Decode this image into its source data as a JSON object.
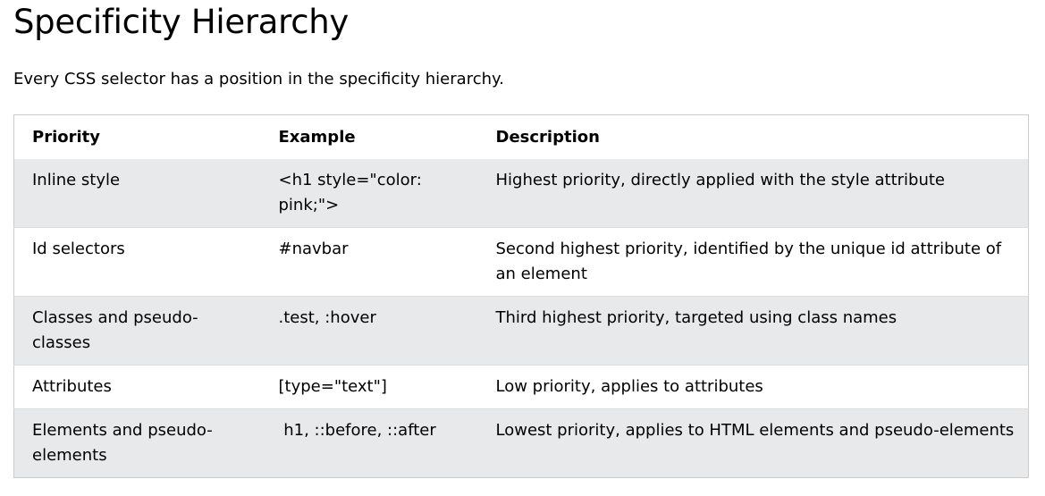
{
  "heading": "Specificity Hierarchy",
  "intro": "Every CSS selector has a position in the specificity hierarchy.",
  "table": {
    "headers": [
      "Priority",
      "Example",
      "Description"
    ],
    "rows": [
      {
        "priority": "Inline style",
        "example": "<h1 style=\"color: pink;\">",
        "description": "Highest priority, directly applied with the style attribute"
      },
      {
        "priority": "Id selectors",
        "example": "#navbar",
        "description": "Second highest priority, identified by the unique id attribute of an element"
      },
      {
        "priority": "Classes and pseudo-classes",
        "example": ".test, :hover",
        "description": "Third highest priority, targeted using class names"
      },
      {
        "priority": "Attributes",
        "example": "[type=\"text\"]",
        "description": "Low priority, applies to attributes"
      },
      {
        "priority": "Elements and pseudo-elements",
        "example": " h1, ::before, ::after",
        "description": "Lowest priority, applies to HTML elements and pseudo-elements"
      }
    ]
  },
  "colors": {
    "stripe": "#e7e9eb",
    "border": "#cccccc",
    "text": "#000000"
  }
}
